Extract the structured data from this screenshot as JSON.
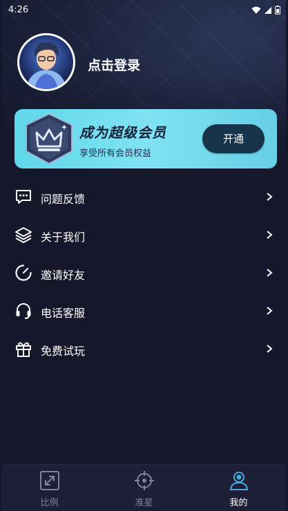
{
  "status_bar": {
    "time": "4:26"
  },
  "profile": {
    "login_text": "点击登录"
  },
  "vip_banner": {
    "title": "成为超级会员",
    "subtitle": "享受所有会员权益",
    "button_label": "开通"
  },
  "menu": {
    "items": [
      {
        "label": "问题反馈",
        "icon": "feedback-chat-icon"
      },
      {
        "label": "关于我们",
        "icon": "layers-icon"
      },
      {
        "label": "邀请好友",
        "icon": "timer-icon"
      },
      {
        "label": "电话客服",
        "icon": "headset-icon"
      },
      {
        "label": "免费试玩",
        "icon": "gift-icon"
      }
    ]
  },
  "tabbar": {
    "tabs": [
      {
        "label": "比例",
        "icon": "expand-icon",
        "active": false
      },
      {
        "label": "准星",
        "icon": "crosshair-icon",
        "active": false
      },
      {
        "label": "我的",
        "icon": "user-icon",
        "active": true
      }
    ]
  },
  "colors": {
    "background": "#15172b",
    "vip_gradient_start": "#5fd7ea",
    "vip_button": "#17334a",
    "active_tab": "#4aa8e0",
    "inactive_tab": "#7f849c"
  }
}
